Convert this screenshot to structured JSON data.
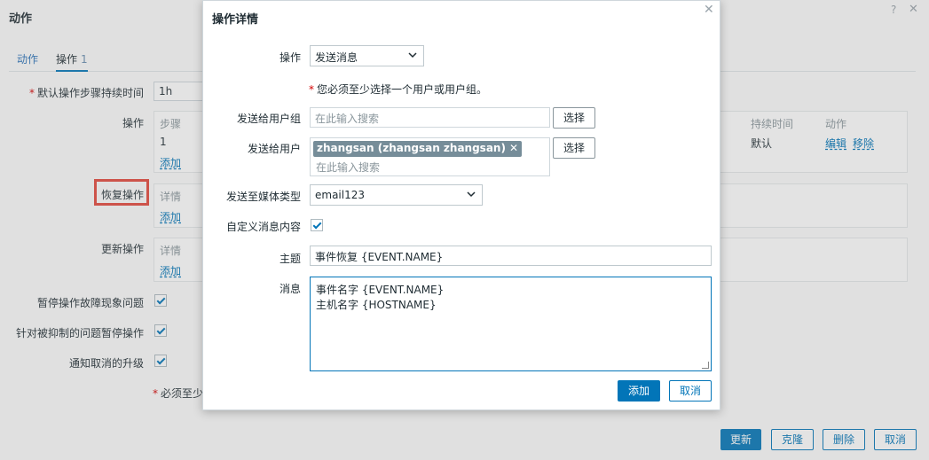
{
  "background": {
    "title": "动作",
    "help_icon": "?",
    "close_icon": "✕",
    "tabs": [
      {
        "label": "动作"
      },
      {
        "label": "操作",
        "count": "1"
      }
    ],
    "default_duration_label": "默认操作步骤持续时间",
    "default_duration_value": "1h",
    "operations_label": "操作",
    "operations_table": {
      "headers": {
        "step": "步骤",
        "duration": "持续时间",
        "action": "动作"
      },
      "row": {
        "step": "1",
        "duration": "默认",
        "edit": "编辑",
        "remove": "移除"
      },
      "add": "添加"
    },
    "recovery_label": "恢复操作",
    "recovery_detail": "详情",
    "recovery_add": "添加",
    "update_label": "更新操作",
    "update_detail": "详情",
    "update_add": "添加",
    "pause_symptoms_label": "暂停操作故障现象问题",
    "pause_suppressed_label": "针对被抑制的问题暂停操作",
    "notify_cancel_label": "通知取消的升级",
    "required_note_partial": "必须至少",
    "buttons": {
      "update": "更新",
      "clone": "克隆",
      "delete": "删除",
      "cancel": "取消"
    }
  },
  "modal": {
    "title": "操作详情",
    "close_icon": "✕",
    "operation_label": "操作",
    "operation_value": "发送消息",
    "required_note": "您必须至少选择一个用户或用户组。",
    "send_to_groups_label": "发送给用户组",
    "groups_placeholder": "在此输入搜索",
    "select_button": "选择",
    "send_to_users_label": "发送给用户",
    "user_tag": "zhangsan (zhangsan zhangsan)",
    "users_placeholder": "在此输入搜索",
    "media_type_label": "发送至媒体类型",
    "media_type_value": "email123",
    "custom_message_label": "自定义消息内容",
    "subject_label": "主题",
    "subject_value": "事件恢复 {EVENT.NAME}",
    "message_label": "消息",
    "message_line1": "事件名字 {EVENT.NAME}",
    "message_line2": "主机名字 {HOSTNAME}",
    "add_button": "添加",
    "cancel_button": "取消"
  },
  "colors": {
    "accent": "#0275b8",
    "highlight": "#e3473c",
    "tag": "#768d99"
  }
}
